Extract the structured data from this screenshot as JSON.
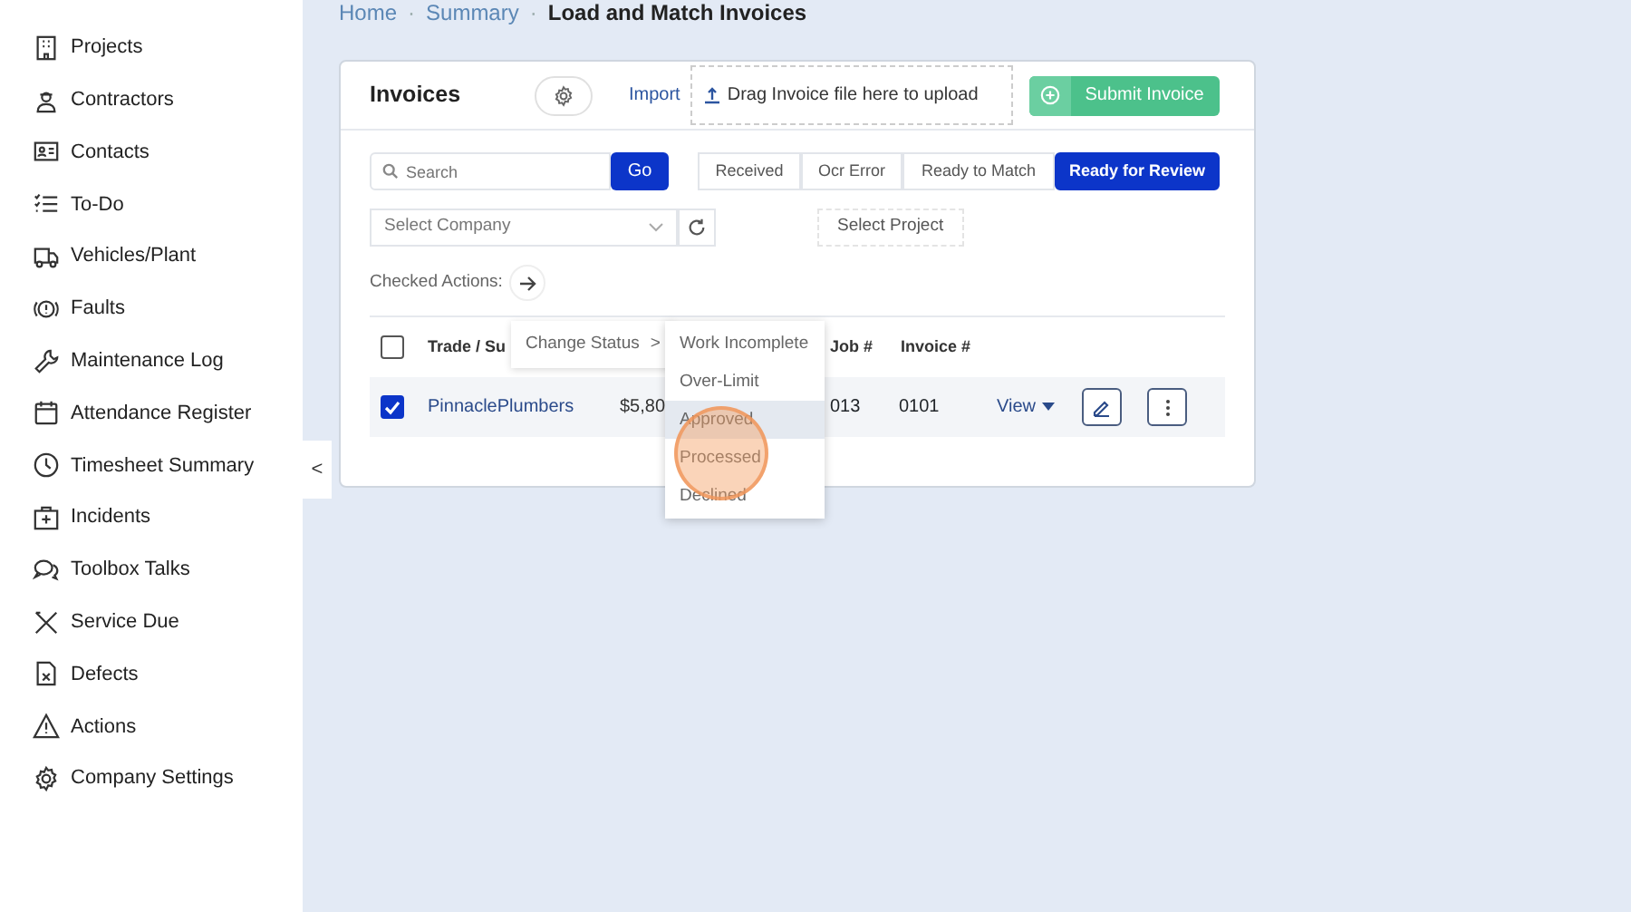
{
  "sidebar": {
    "items": [
      {
        "label": "Projects"
      },
      {
        "label": "Contractors"
      },
      {
        "label": "Contacts"
      },
      {
        "label": "To-Do"
      },
      {
        "label": "Vehicles/Plant"
      },
      {
        "label": "Faults"
      },
      {
        "label": "Maintenance Log"
      },
      {
        "label": "Attendance Register"
      },
      {
        "label": "Timesheet Summary"
      },
      {
        "label": "Incidents"
      },
      {
        "label": "Toolbox Talks"
      },
      {
        "label": "Service Due"
      },
      {
        "label": "Defects"
      },
      {
        "label": "Actions"
      },
      {
        "label": "Company Settings"
      }
    ],
    "collapse": "<"
  },
  "breadcrumb": {
    "items": [
      "Home",
      "Summary",
      "Load and Match Invoices"
    ],
    "separators": [
      "·",
      "·"
    ]
  },
  "card": {
    "title": "Invoices",
    "import": "Import",
    "upload": "Drag Invoice file here to upload",
    "submit": "Submit Invoice"
  },
  "search": {
    "placeholder": "Search",
    "go": "Go"
  },
  "filters": [
    {
      "label": "Received",
      "selected": false
    },
    {
      "label": "Ocr Error",
      "selected": false
    },
    {
      "label": "Ready to Match",
      "selected": false
    },
    {
      "label": "Ready for Review",
      "selected": true
    }
  ],
  "company_select": {
    "placeholder": "Select Company"
  },
  "project_button": "Select Project",
  "checked_actions": "Checked Actions:",
  "table": {
    "columns": [
      "Trade / Su",
      "Job #",
      "Invoice #"
    ],
    "rows": [
      {
        "checked": true,
        "trade": "PinnaclePlumbers",
        "amount": "$5,80",
        "job": "013",
        "invoice": "0101",
        "view": "View"
      }
    ],
    "header_checked": false
  },
  "context_menu": {
    "label": "Change Status",
    "arrow": ">"
  },
  "status_menu": [
    {
      "label": "Work Incomplete",
      "selected": false
    },
    {
      "label": "Over-Limit",
      "selected": false
    },
    {
      "label": "Approved",
      "selected": true
    },
    {
      "label": "Processed",
      "selected": false
    },
    {
      "label": "Declined",
      "selected": false
    }
  ]
}
